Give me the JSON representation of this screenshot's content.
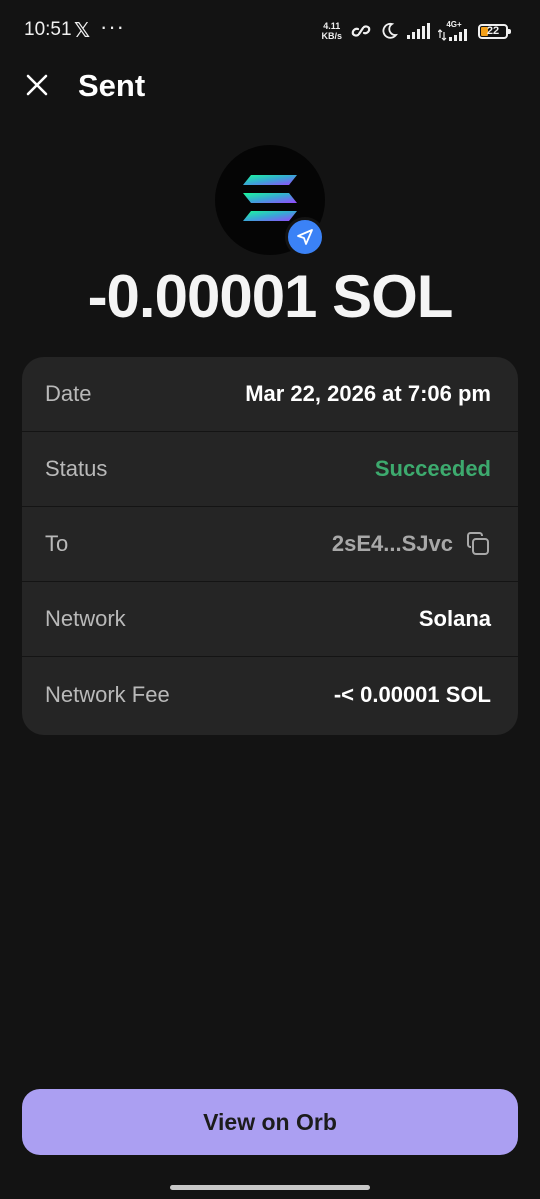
{
  "status_bar": {
    "time": "10:51",
    "x_logo": "𝕏",
    "more": "···",
    "speed_value": "4.11",
    "speed_unit": "KB/s",
    "network_label": "4G+",
    "battery": "22"
  },
  "header": {
    "title": "Sent"
  },
  "token": {
    "icon": "solana-logo-icon",
    "badge_icon": "send-arrow-icon",
    "badge_color": "#3b82f6"
  },
  "amount": "-0.00001 SOL",
  "details": [
    {
      "label": "Date",
      "value": "Mar 22, 2026 at 7:06 pm"
    },
    {
      "label": "Status",
      "value": "Succeeded",
      "color": "#3daa6e"
    },
    {
      "label": "To",
      "value": "2sE4...SJvc",
      "icon": "copy-icon"
    },
    {
      "label": "Network",
      "value": "Solana"
    },
    {
      "label": "Network Fee",
      "value": "-< 0.00001 SOL"
    }
  ],
  "footer": {
    "button_label": "View on Orb",
    "button_color": "#ab9ff2"
  }
}
